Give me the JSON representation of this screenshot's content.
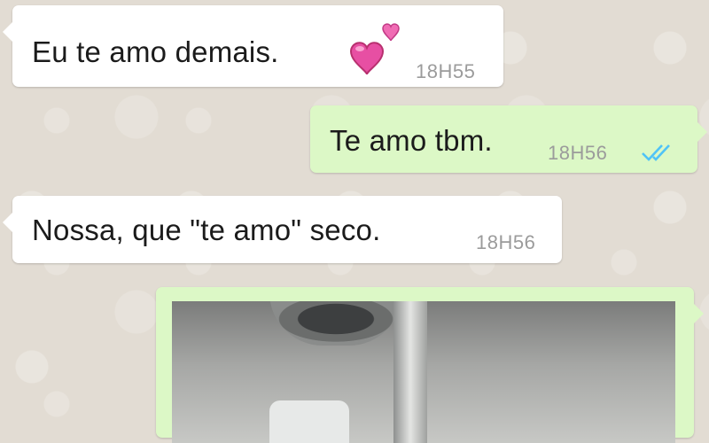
{
  "messages": [
    {
      "direction": "incoming",
      "text": "Eu te amo demais.",
      "emoji": "two-hearts",
      "time": "18H55"
    },
    {
      "direction": "outgoing",
      "text": "Te amo tbm.",
      "time": "18H56",
      "status": "read-double-check"
    },
    {
      "direction": "incoming",
      "text": "Nossa, que \"te amo\" seco.",
      "time": "18H56"
    },
    {
      "direction": "outgoing",
      "type": "image"
    }
  ],
  "colors": {
    "incoming_bubble": "#ffffff",
    "outgoing_bubble": "#dcf8c6",
    "read_ticks": "#4fc3f7",
    "timestamp": "#9b9b9b",
    "heart": "#e74fa3"
  }
}
